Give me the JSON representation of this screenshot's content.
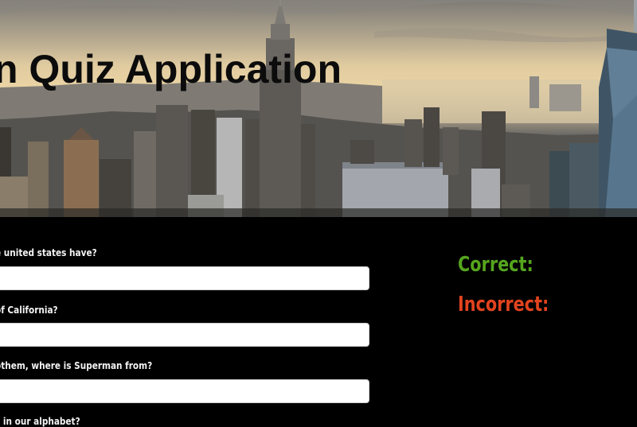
{
  "app": {
    "title": "n Quiz Application"
  },
  "questions": [
    {
      "text": "e united states have?",
      "answer_value": ""
    },
    {
      "text": "of California?",
      "answer_value": ""
    },
    {
      "text": "othem, where is Superman from?",
      "answer_value": ""
    },
    {
      "text": "s in our alphabet?",
      "answer_value": ""
    }
  ],
  "score": {
    "correct_label": "Correct:",
    "incorrect_label": "Incorrect:",
    "correct_color": "#55a51e",
    "incorrect_color": "#e2431f"
  },
  "colors": {
    "background": "#000000",
    "title": "#0c0c0c",
    "question_text": "#f2f2f2",
    "answer_field": "#ffffff"
  }
}
